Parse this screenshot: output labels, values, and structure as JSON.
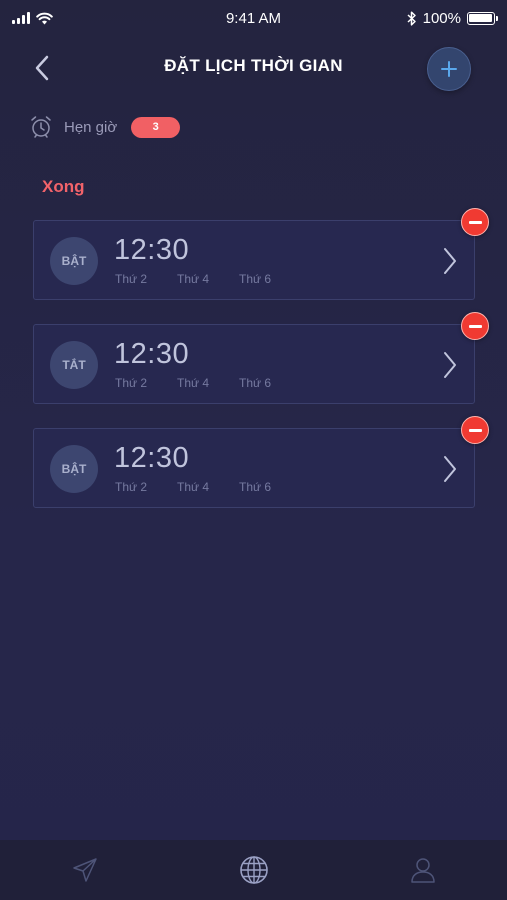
{
  "status_bar": {
    "time": "9:41 AM",
    "battery": "100%",
    "icons": [
      "signal-icon",
      "wifi-icon",
      "bluetooth-icon",
      "battery-icon"
    ]
  },
  "header": {
    "title": "ĐẶT LỊCH THỜI GIAN",
    "back_icon": "chevron-left-icon",
    "add_icon": "plus-icon"
  },
  "timer": {
    "label": "Hẹn giờ",
    "count": "3",
    "icon": "alarm-clock-icon"
  },
  "done_label": "Xong",
  "schedules": [
    {
      "toggle": "BẬT",
      "time": "12:30",
      "days": [
        "Thứ 2",
        "Thứ 4",
        "Thứ 6"
      ]
    },
    {
      "toggle": "TẮT",
      "time": "12:30",
      "days": [
        "Thứ 2",
        "Thứ 4",
        "Thứ 6"
      ]
    },
    {
      "toggle": "BẬT",
      "time": "12:30",
      "days": [
        "Thứ 2",
        "Thứ 4",
        "Thứ 6"
      ]
    }
  ],
  "tab_bar": {
    "tabs": [
      "send-icon",
      "globe-icon",
      "user-icon"
    ],
    "active": "globe-icon"
  },
  "colors": {
    "background": "#24243f",
    "accent_red": "#f16064",
    "delete_red": "#f03a32",
    "add_button": "#33456e",
    "card_border": "#3b3f6c"
  }
}
